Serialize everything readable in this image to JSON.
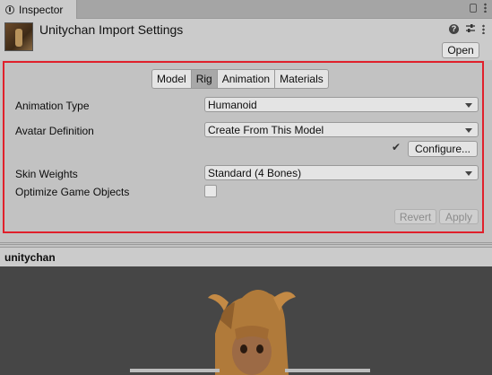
{
  "window": {
    "tab_label": "Inspector",
    "tab_icon": "info-icon"
  },
  "header": {
    "title": "Unitychan Import Settings",
    "open_label": "Open",
    "help_icon": "help-icon",
    "settings_icon": "sliders-icon",
    "menu_icon": "kebab-menu-icon"
  },
  "tabs": [
    {
      "label": "Model",
      "active": false
    },
    {
      "label": "Rig",
      "active": true
    },
    {
      "label": "Animation",
      "active": false
    },
    {
      "label": "Materials",
      "active": false
    }
  ],
  "fields": {
    "animation_type": {
      "label": "Animation Type",
      "value": "Humanoid"
    },
    "avatar_definition": {
      "label": "Avatar Definition",
      "value": "Create From This Model"
    },
    "configure_label": "Configure...",
    "check_glyph": "✔",
    "skin_weights": {
      "label": "Skin Weights",
      "value": "Standard (4 Bones)"
    },
    "optimize": {
      "label": "Optimize Game Objects",
      "checked": false
    }
  },
  "actions": {
    "revert_label": "Revert",
    "apply_label": "Apply"
  },
  "preview": {
    "title": "unitychan"
  },
  "colors": {
    "highlight": "#e0202b",
    "viewport_bg": "#464646",
    "panel_bg": "#c2c2c2"
  }
}
